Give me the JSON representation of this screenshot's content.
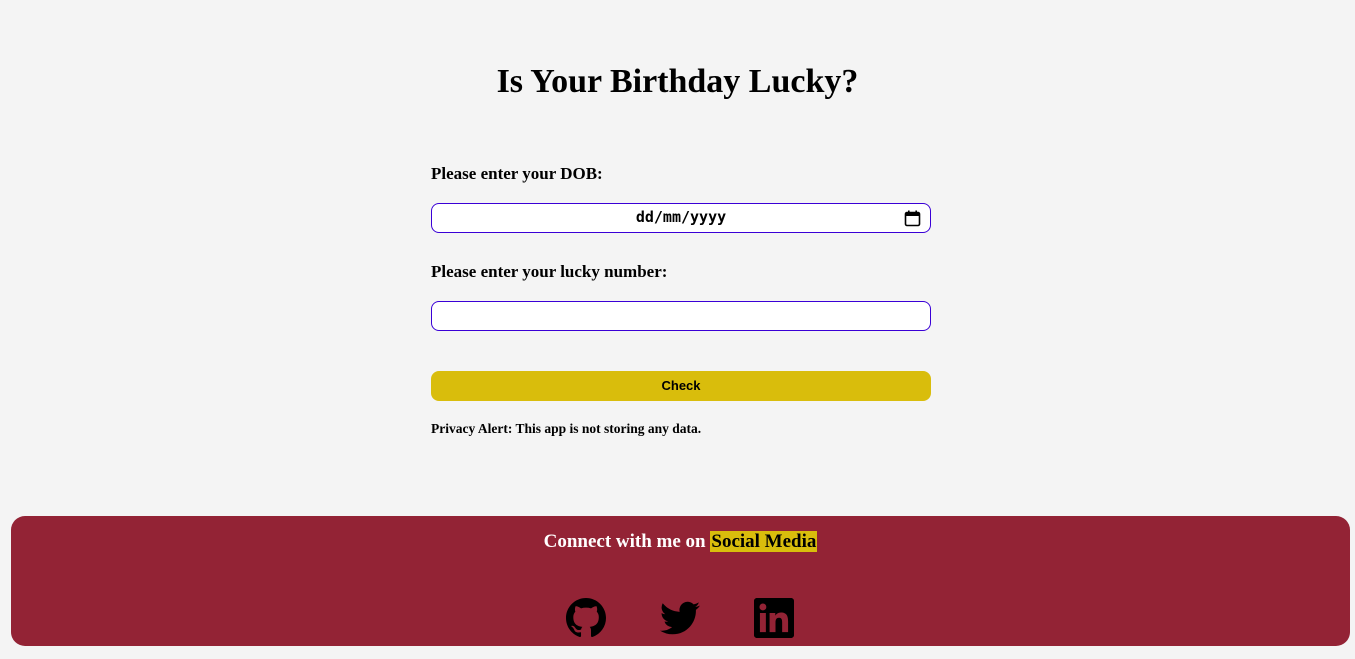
{
  "header": {
    "title": "Is Your Birthday Lucky?"
  },
  "form": {
    "dob_label": "Please enter your DOB:",
    "dob_placeholder": "dd/mm/yyyy",
    "lucky_label": "Please enter your lucky number:",
    "lucky_value": "",
    "check_label": "Check",
    "privacy_text": "Privacy Alert: This app is not storing any data."
  },
  "footer": {
    "heading_prefix": "Connect with me on",
    "heading_highlight": "Social Media",
    "links": [
      {
        "name": "github",
        "icon": "github-icon"
      },
      {
        "name": "twitter",
        "icon": "twitter-icon"
      },
      {
        "name": "linkedin",
        "icon": "linkedin-icon"
      }
    ]
  },
  "colors": {
    "background": "#f4f4f4",
    "input_border": "#3a00d6",
    "button": "#d9bd0c",
    "footer": "#932335",
    "highlight": "#d9bd0c"
  }
}
